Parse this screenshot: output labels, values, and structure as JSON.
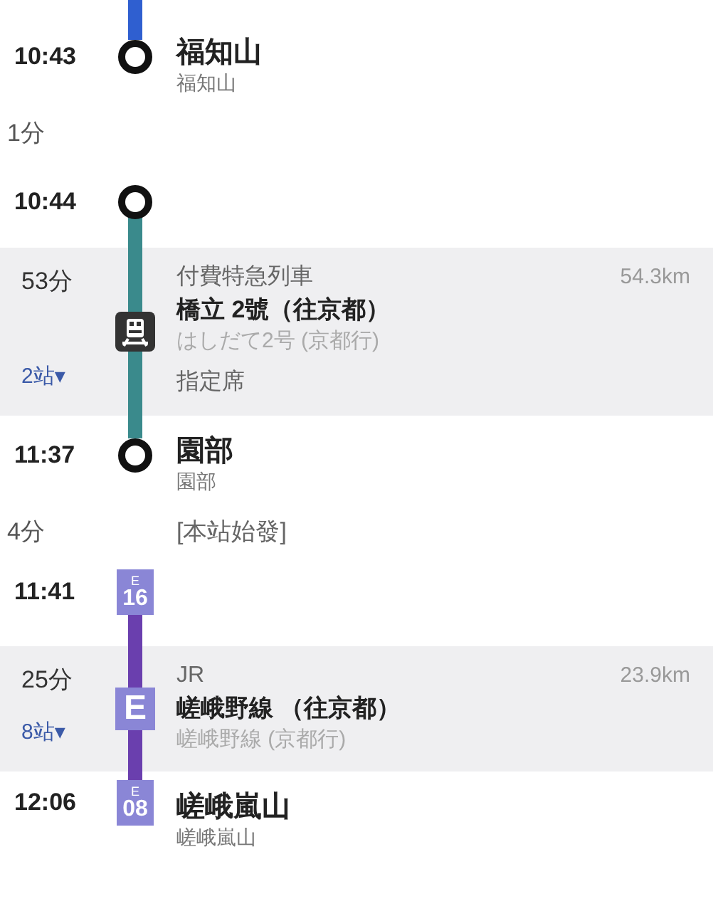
{
  "items": [
    {
      "kind": "segment",
      "color": "#2f5fd0"
    },
    {
      "kind": "station",
      "time": "10:43",
      "marker": {
        "kind": "circle"
      },
      "name": "福知山",
      "subname": "福知山"
    },
    {
      "kind": "transfer",
      "duration": "1分"
    },
    {
      "kind": "station",
      "time": "10:44",
      "marker": {
        "kind": "circle"
      }
    },
    {
      "kind": "ride",
      "color": "#3a8a8c",
      "duration": "53分",
      "stops": "2站▾",
      "icon": {
        "kind": "train"
      },
      "category": "付費特急列車",
      "name": "橋立 2號（往京都）",
      "subname": "はしだて2号 (京都行)",
      "note": "指定席",
      "distance": "54.3km"
    },
    {
      "kind": "station",
      "time": "11:37",
      "marker": {
        "kind": "circle"
      },
      "name": "園部",
      "subname": "園部"
    },
    {
      "kind": "transfer",
      "duration": "4分",
      "note": "[本站始發]"
    },
    {
      "kind": "station",
      "time": "11:41",
      "marker": {
        "kind": "badge",
        "line": "E",
        "number": "16"
      }
    },
    {
      "kind": "ride",
      "color": "#6a3fae",
      "duration": "25分",
      "stops": "8站▾",
      "icon": {
        "kind": "line-badge",
        "text": "E"
      },
      "category": "JR",
      "name": "嵯峨野線 （往京都）",
      "subname": "嵯峨野線 (京都行)",
      "distance": "23.9km"
    },
    {
      "kind": "station",
      "time": "12:06",
      "marker": {
        "kind": "badge",
        "line": "E",
        "number": "08"
      },
      "name": "嵯峨嵐山",
      "subname": "嵯峨嵐山"
    }
  ]
}
